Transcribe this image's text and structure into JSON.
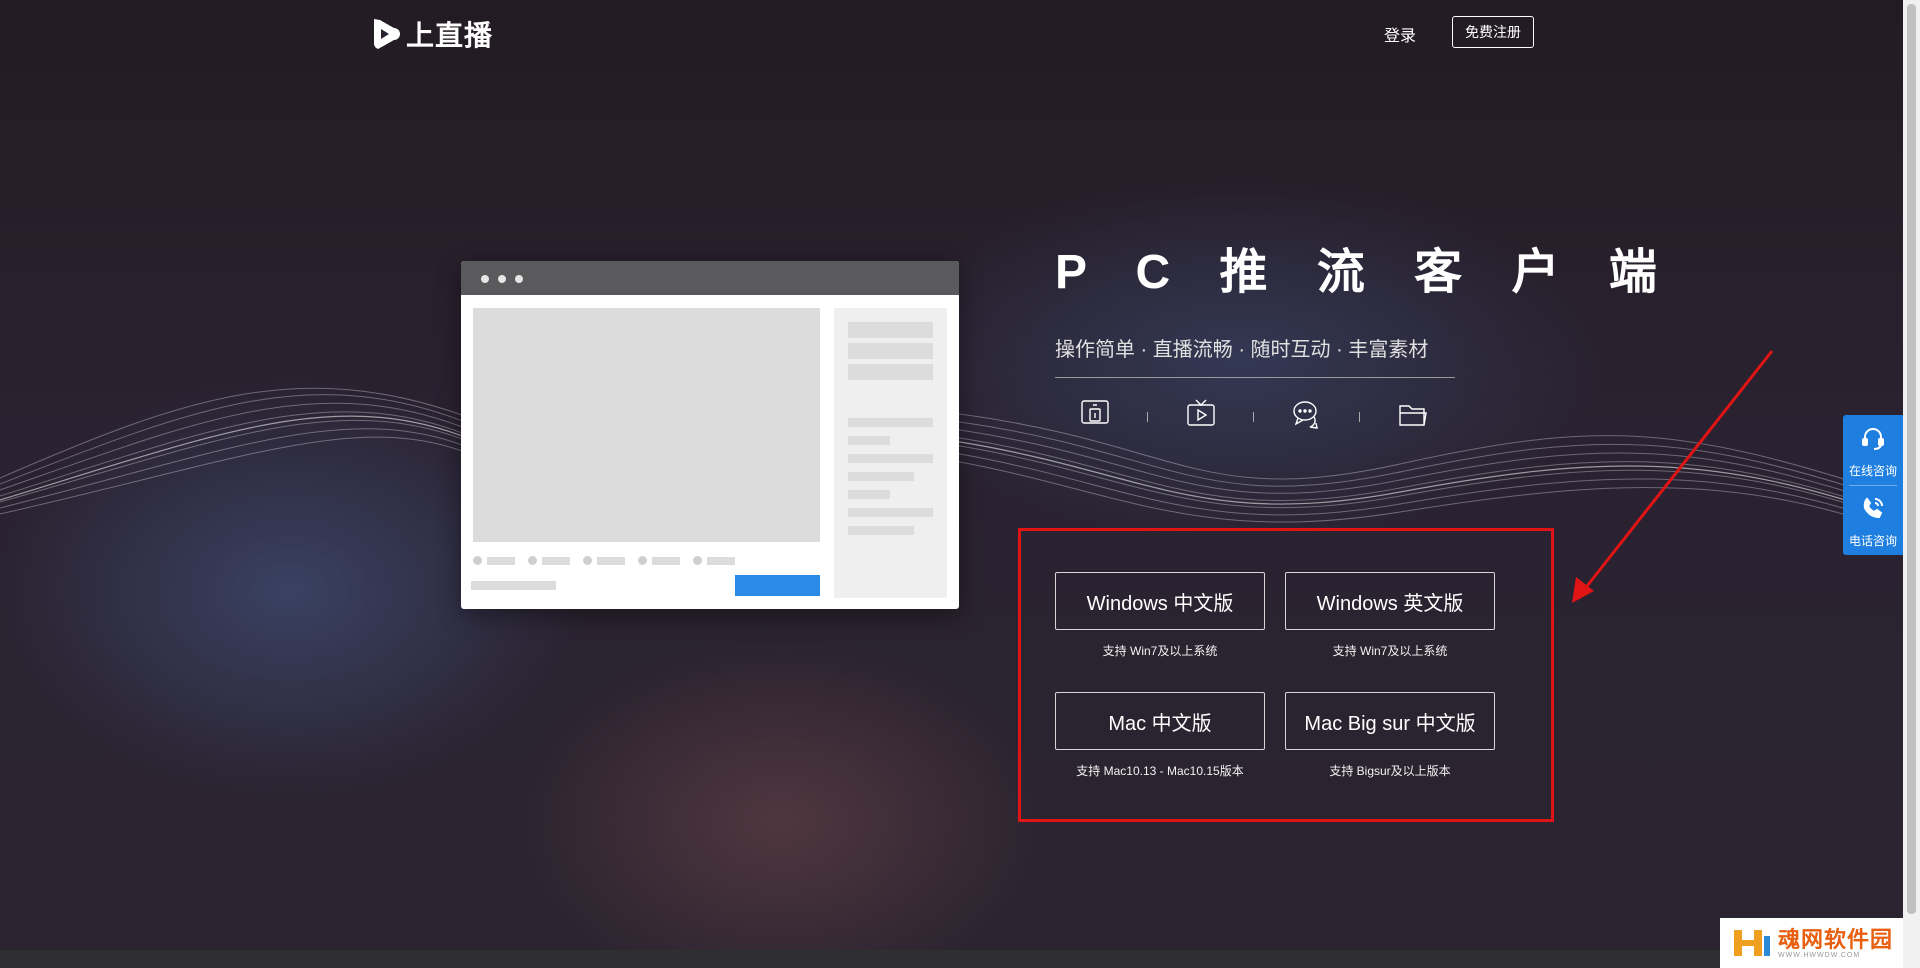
{
  "header": {
    "logo_text": "上直播",
    "login_label": "登录",
    "register_label": "免费注册"
  },
  "hero": {
    "title": "P C 推 流 客 户 端",
    "subtitle": "操作简单 · 直播流畅 · 随时互动 · 丰富素材",
    "feature_icons": [
      "screen-share-icon",
      "tv-play-icon",
      "chat-bubbles-icon",
      "folder-icon"
    ]
  },
  "downloads": [
    {
      "label": "Windows 中文版",
      "note": "支持 Win7及以上系统"
    },
    {
      "label": "Windows 英文版",
      "note": "支持 Win7及以上系统"
    },
    {
      "label": "Mac 中文版",
      "note": "支持 Mac10.13 - Mac10.15版本"
    },
    {
      "label": "Mac Big sur 中文版",
      "note": "支持 Bigsur及以上版本"
    }
  ],
  "side_widget": {
    "online_label": "在线咨询",
    "phone_label": "电话咨询"
  },
  "watermark": {
    "main": "魂网软件园",
    "sub": "WWW.HWWDW.COM"
  },
  "colors": {
    "accent_blue": "#1f7fe0",
    "highlight_red": "#e01414",
    "mock_button_blue": "#2b8ae8"
  }
}
